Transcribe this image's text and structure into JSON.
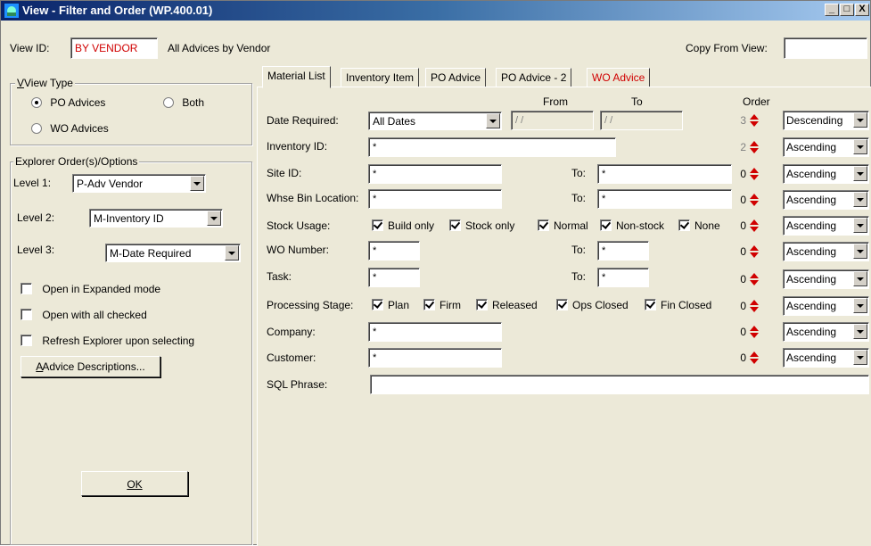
{
  "window": {
    "title": "View - Filter and Order (WP.400.01)",
    "minimize": "_",
    "maximize": "□",
    "close": "X"
  },
  "header": {
    "view_id_label": "View ID:",
    "view_id_value": "BY VENDOR",
    "view_description": "All Advices by Vendor",
    "copy_from_label": "Copy From View:",
    "copy_from_value": ""
  },
  "view_type": {
    "title": "View Type",
    "options": [
      {
        "label": "PO Advices",
        "selected": true
      },
      {
        "label": "Both",
        "selected": false
      },
      {
        "label": "WO Advices",
        "selected": false
      }
    ]
  },
  "explorer": {
    "title": "Explorer Order(s)/Options",
    "level1_label": "Level 1:",
    "level1_value": "P-Adv Vendor",
    "level2_label": "Level 2:",
    "level2_value": "M-Inventory ID",
    "level3_label": "Level 3:",
    "level3_value": "M-Date Required",
    "checks": [
      {
        "label": "Open in Expanded mode",
        "checked": false
      },
      {
        "label": "Open with all checked",
        "checked": false
      },
      {
        "label": "Refresh Explorer upon selecting",
        "checked": false
      }
    ],
    "advice_button": "Advice Descriptions..."
  },
  "ok_button": "OK",
  "tabs": [
    {
      "label": "Material List",
      "active": true
    },
    {
      "label": "Inventory Item",
      "active": false
    },
    {
      "label": "PO Advice",
      "active": false
    },
    {
      "label": "PO Advice - 2",
      "active": false
    },
    {
      "label": "WO Advice",
      "active": false,
      "color": "#d00000"
    }
  ],
  "columns": {
    "from": "From",
    "to": "To",
    "order": "Order"
  },
  "to_label": "To:",
  "rows": {
    "date_required": {
      "label": "Date Required:",
      "combo": "All Dates",
      "from": "/ /",
      "to": "/ /",
      "order": "3",
      "sort": "Descending"
    },
    "inventory_id": {
      "label": "Inventory ID:",
      "value": "*",
      "order": "2",
      "sort": "Ascending"
    },
    "site_id": {
      "label": "Site ID:",
      "from": "*",
      "to": "*",
      "order": "0",
      "sort": "Ascending"
    },
    "whse_bin": {
      "label": "Whse Bin Location:",
      "from": "*",
      "to": "*",
      "order": "0",
      "sort": "Ascending"
    },
    "stock_usage": {
      "label": "Stock Usage:",
      "checks": [
        "Build only",
        "Stock only",
        "Normal",
        "Non-stock",
        "None"
      ],
      "order": "0",
      "sort": "Ascending"
    },
    "wo_number": {
      "label": "WO Number:",
      "from": "*",
      "to": "*",
      "order": "0",
      "sort": "Ascending"
    },
    "task": {
      "label": "Task:",
      "from": "*",
      "to": "*",
      "order": "0",
      "sort": "Ascending"
    },
    "processing_stage": {
      "label": "Processing Stage:",
      "checks": [
        "Plan",
        "Firm",
        "Released",
        "Ops Closed",
        "Fin Closed"
      ],
      "order": "0",
      "sort": "Ascending"
    },
    "company": {
      "label": "Company:",
      "value": "*",
      "order": "0",
      "sort": "Ascending"
    },
    "customer": {
      "label": "Customer:",
      "value": "*",
      "order": "0",
      "sort": "Ascending"
    },
    "sql_phrase": {
      "label": "SQL Phrase:",
      "value": ""
    }
  },
  "colors": {
    "title_start": "#0a246a",
    "accent_red": "#d00000",
    "face": "#ece9d8"
  }
}
